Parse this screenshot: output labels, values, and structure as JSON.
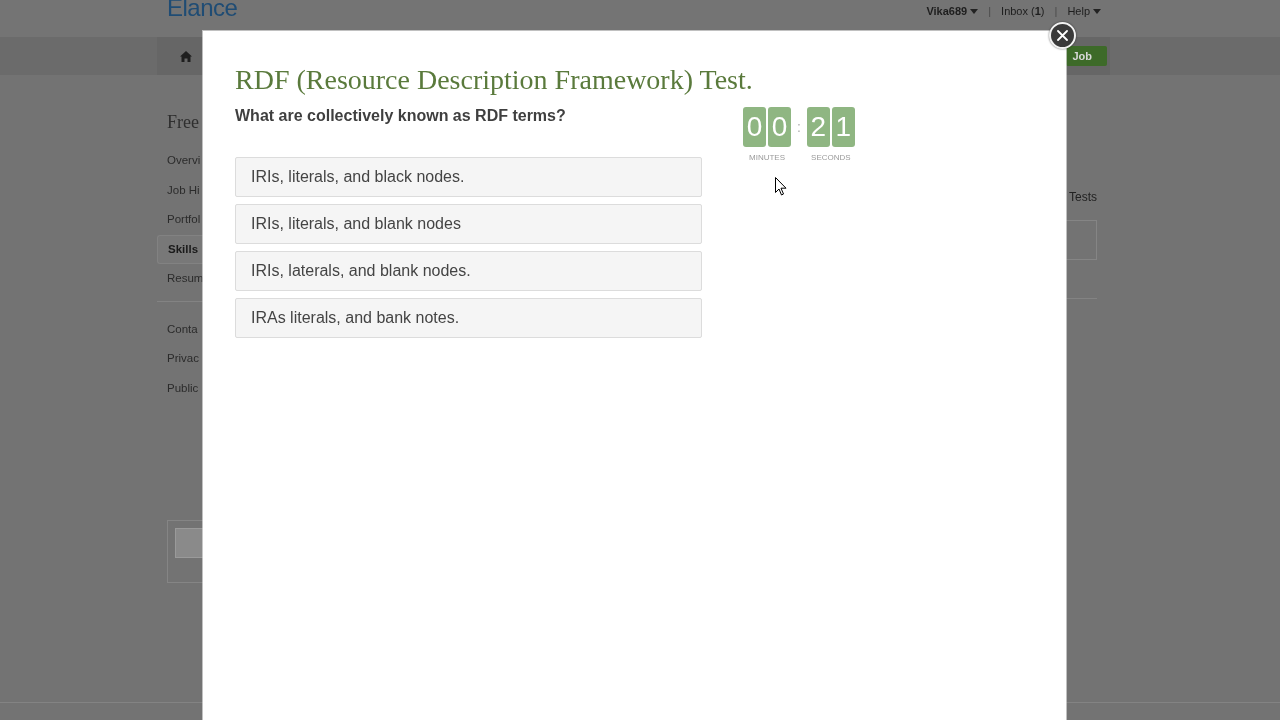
{
  "header": {
    "logo": "Elance",
    "user_menu": "Vika689",
    "separators": [
      "|",
      "|"
    ],
    "inbox": "Inbox (**1**)",
    "help_menu": "Help"
  },
  "nav_bar": {
    "button": "Job"
  },
  "sidebar": {
    "title": "Free",
    "groups": [
      {
        "items": [
          {
            "label": "Overvi",
            "selected": false
          },
          {
            "label": "Job Hi",
            "selected": false
          },
          {
            "label": "Portfol",
            "selected": false
          },
          {
            "label": "Skills",
            "selected": true
          },
          {
            "label": "Resum",
            "selected": false
          }
        ]
      },
      {
        "items": [
          {
            "label": "Conta",
            "selected": false
          },
          {
            "label": "Privac",
            "selected": false
          },
          {
            "label": "Public",
            "selected": false
          }
        ]
      }
    ]
  },
  "side_panel": {
    "heading": "Tests"
  },
  "dialog": {
    "title": "RDF (Resource Description Framework) Test.",
    "question": "What are collectively known as RDF terms?",
    "options": [
      {
        "label": "IRIs, literals, and black nodes.",
        "selected": false
      },
      {
        "label": "IRIs, literals, and blank nodes",
        "selected": false
      },
      {
        "label": "IRIs, laterals, and blank nodes.",
        "selected": false
      },
      {
        "label": "IRAs literals, and bank notes.",
        "selected": false
      }
    ],
    "timer": {
      "minutes": [
        "0",
        "0"
      ],
      "separator": ":",
      "seconds": [
        "2",
        "1"
      ],
      "minutes_label": "MINUTES",
      "seconds_label": "SECONDS"
    }
  }
}
